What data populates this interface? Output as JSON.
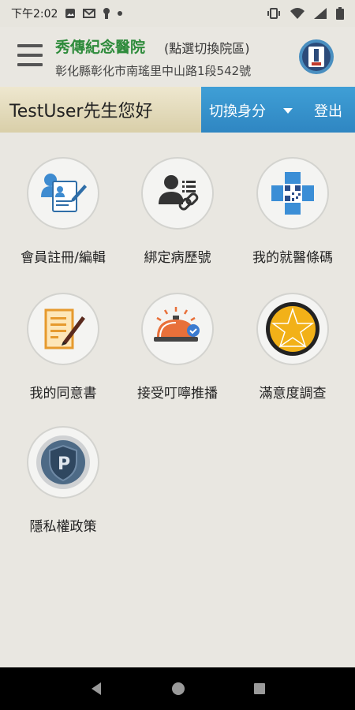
{
  "status_bar": {
    "time": "下午2:02"
  },
  "header": {
    "hospital_name": "秀傳紀念醫院",
    "switch_hint": "(點選切換院區)",
    "address": "彰化縣彰化市南瑤里中山路1段542號",
    "menu_icon": "hamburger-menu-icon",
    "logo_icon": "hospital-logo-icon"
  },
  "user_bar": {
    "greeting": "TestUser先生您好",
    "switch_identity": "切換身分",
    "logout": "登出"
  },
  "tiles": [
    {
      "label": "會員註冊/編輯",
      "icon": "member-register-icon"
    },
    {
      "label": "綁定病歷號",
      "icon": "bind-record-icon"
    },
    {
      "label": "我的就醫條碼",
      "icon": "medical-barcode-icon"
    },
    {
      "label": "我的同意書",
      "icon": "consent-form-icon"
    },
    {
      "label": "接受叮嚀推播",
      "icon": "reminder-bell-icon"
    },
    {
      "label": "滿意度調查",
      "icon": "satisfaction-survey-icon"
    },
    {
      "label": "隱私權政策",
      "icon": "privacy-policy-icon"
    }
  ],
  "colors": {
    "hospital_green": "#2e8b3b",
    "action_blue": "#2f86c2",
    "background": "#e9e7e1"
  }
}
